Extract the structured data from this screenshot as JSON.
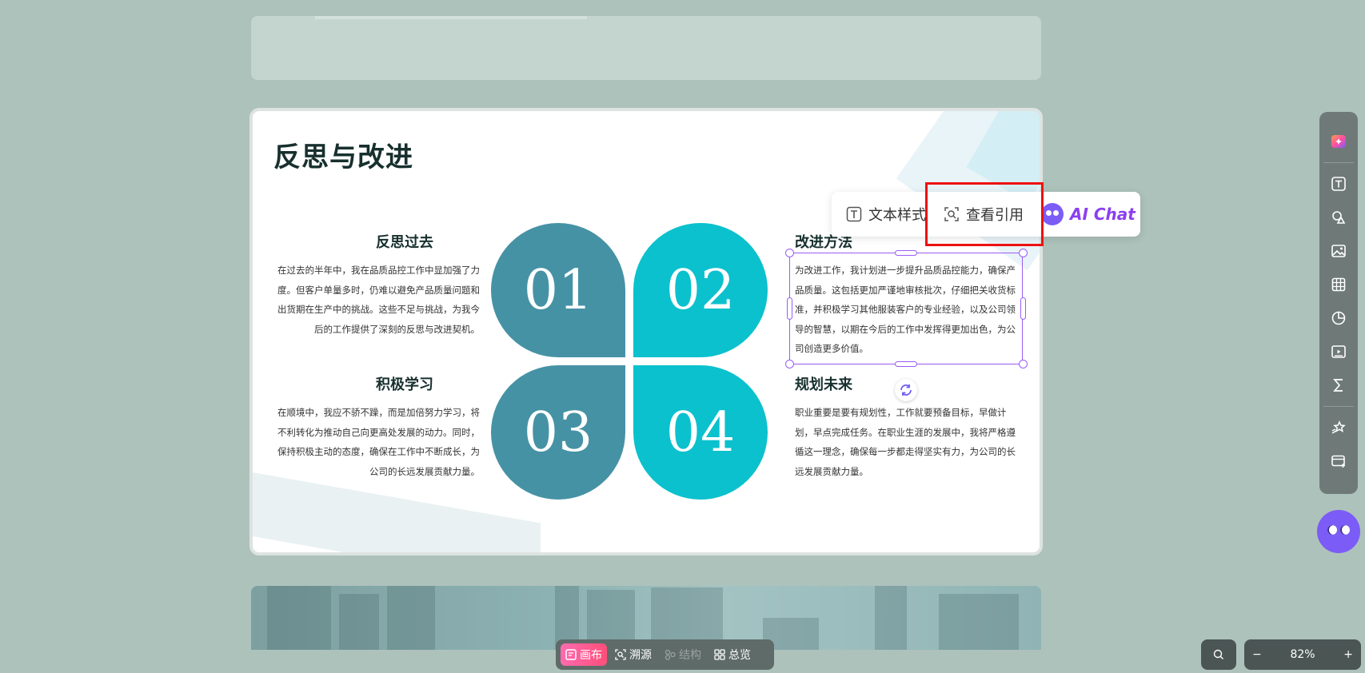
{
  "slide": {
    "title": "反思与改进",
    "sections": {
      "s1": {
        "title": "反思过去",
        "body": "在过去的半年中，我在品质品控工作中显加强了力度。但客户单量多时，仍难以避免产品质量问题和出货期在生产中的挑战。这些不足与挑战，为我今后的工作提供了深刻的反思与改进契机。"
      },
      "s2": {
        "title": "改进方法",
        "body": "为改进工作，我计划进一步提升品质品控能力，确保产品质量。这包括更加严谨地审核批次，仔细把关收货标准，并积极学习其他服装客户的专业经验，以及公司领导的智慧，以期在今后的工作中发挥得更加出色，为公司创造更多价值。"
      },
      "s3": {
        "title": "积极学习",
        "body": "在顺境中，我应不骄不躁，而是加倍努力学习，将不利转化为推动自己向更高处发展的动力。同时，保持积极主动的态度，确保在工作中不断成长，为公司的长远发展贡献力量。"
      },
      "s4": {
        "title": "规划未来",
        "body": "职业重要是要有规划性，工作就要预备目标，早做计划，早点完成任务。在职业生涯的发展中，我将严格遵循这一理念，确保每一步都走得坚实有力，为公司的长远发展贡献力量。"
      }
    },
    "petals": [
      "01",
      "02",
      "03",
      "04"
    ]
  },
  "toolbar": {
    "text_style": "文本样式",
    "view_refs": "查看引用",
    "ai_chat": "AI Chat"
  },
  "bottom_bar": {
    "canvas": "画布",
    "source": "溯源",
    "structure": "结构",
    "overview": "总览"
  },
  "zoom": {
    "minus": "−",
    "level": "82%",
    "plus": "+"
  },
  "colors": {
    "teal_dark": "#4692a5",
    "teal_light": "#0bc1cd",
    "selection": "#9b5cf6",
    "highlight": "#e11111",
    "ai_purple": "#8a3ff0"
  },
  "icons": {
    "right_sidebar": [
      "ai-sparkle-icon",
      "text-icon",
      "shape-icon",
      "image-icon",
      "table-icon",
      "chart-icon",
      "media-icon",
      "formula-icon",
      "animation-icon",
      "card-add-icon"
    ]
  }
}
